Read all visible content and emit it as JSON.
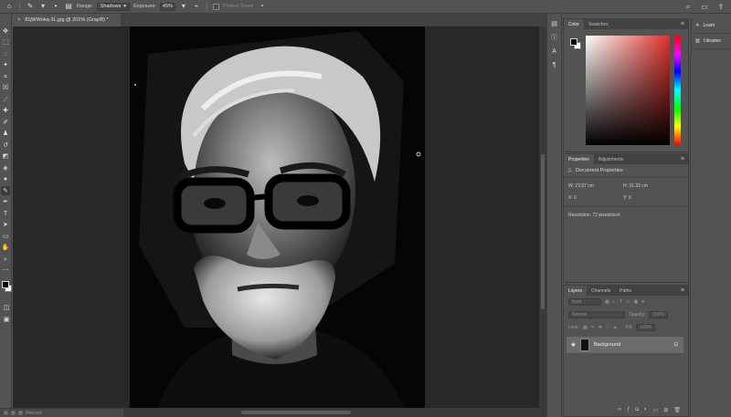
{
  "options_bar": {
    "range_label": "Range:",
    "range_value": "Shadows",
    "exposure_label": "Exposure:",
    "exposure_value": "45%",
    "protect_label": "Protect Tones"
  },
  "document_tab": {
    "title": "81jWWokq-3L.jpg @ 201% (Gray/8) *"
  },
  "record": {
    "label": "Record"
  },
  "color_panel": {
    "tabs": [
      "Color",
      "Swatches"
    ],
    "foreground": "#000000",
    "background": "#ffffff"
  },
  "properties_panel": {
    "tabs": [
      "Properties",
      "Adjustments"
    ],
    "heading": "Document Properties",
    "w": "W: 23.67 cm",
    "h": "H: 31.33 cm",
    "x": "X: 0",
    "y": "Y: 0",
    "resolution": "Resolution: 72 pixels/inch"
  },
  "layers_panel": {
    "tabs": [
      "Layers",
      "Channels",
      "Paths"
    ],
    "kind": "Kind",
    "blend": "Normal",
    "opacity_label": "Opacity:",
    "opacity_value": "100%",
    "lock_label": "Lock:",
    "fill_label": "Fill:",
    "fill_value": "100%",
    "layer_name": "Background"
  },
  "learn": {
    "learn_label": "Learn",
    "libraries_label": "Libraries"
  },
  "colors": {
    "accent": "#e0302a"
  }
}
